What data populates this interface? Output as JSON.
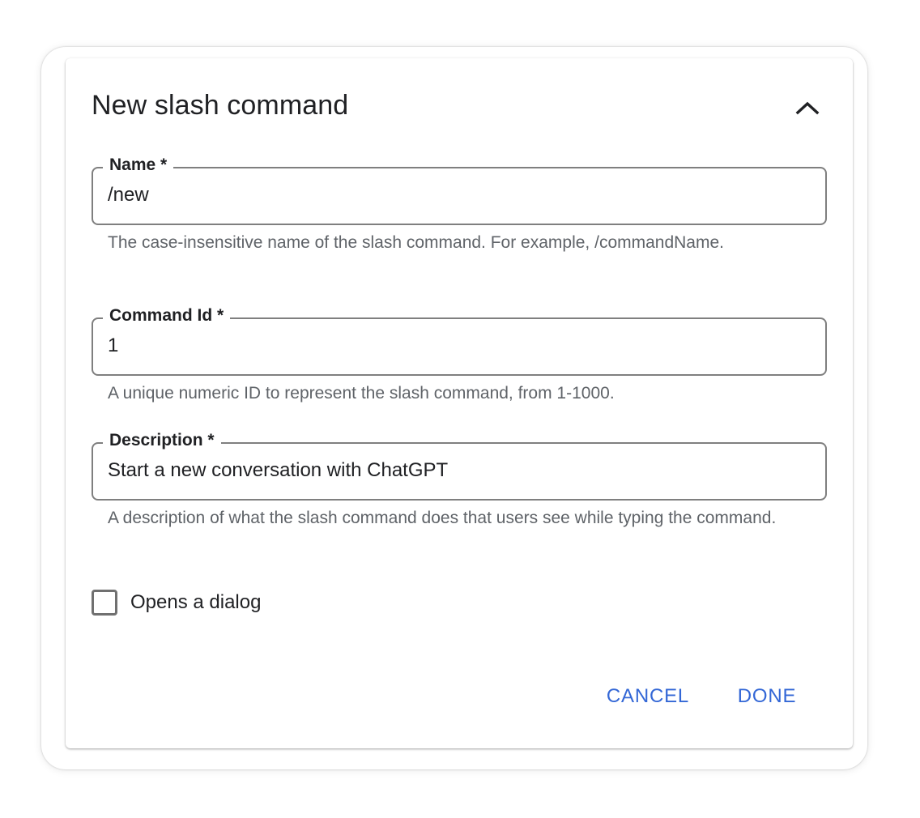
{
  "dialog": {
    "title": "New slash command",
    "collapse_icon": "chevron-up-icon"
  },
  "fields": {
    "name": {
      "label": "Name *",
      "value": "/new",
      "hint": "The case-insensitive name of the slash command. For example, /commandName."
    },
    "command_id": {
      "label": "Command Id *",
      "value": "1",
      "hint": "A unique numeric ID to represent the slash command, from 1-1000."
    },
    "description": {
      "label": "Description *",
      "value": "Start a new conversation with ChatGPT",
      "hint": "A description of what the slash command does that users see while typing the command."
    }
  },
  "opens_dialog": {
    "label": "Opens a dialog",
    "checked": false
  },
  "actions": {
    "cancel_label": "CANCEL",
    "done_label": "DONE"
  },
  "colors": {
    "accent": "#3367d6",
    "text": "#202124",
    "hint": "#5f6368",
    "border": "#7f7f7f"
  }
}
